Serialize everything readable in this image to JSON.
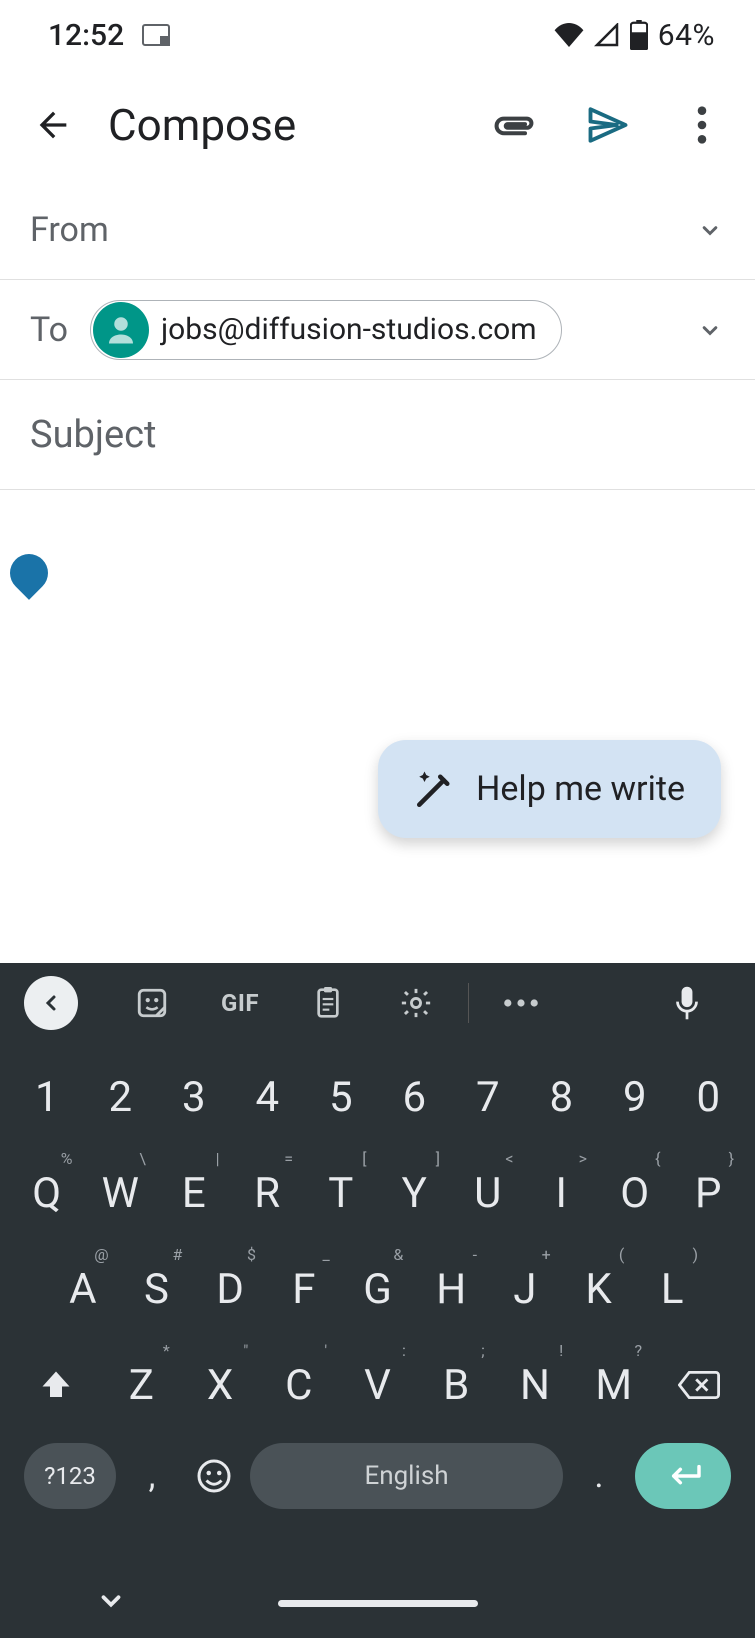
{
  "status": {
    "time": "12:52",
    "battery_pct": "64%"
  },
  "appbar": {
    "title": "Compose"
  },
  "fields": {
    "from_label": "From",
    "to_label": "To",
    "to_chip": "jobs@diffusion-studios.com",
    "subject_placeholder": "Subject"
  },
  "help_me_write": {
    "label": "Help me write"
  },
  "keyboard": {
    "suggestion_gif": "GIF",
    "row1": [
      "1",
      "2",
      "3",
      "4",
      "5",
      "6",
      "7",
      "8",
      "9",
      "0"
    ],
    "row2": {
      "keys": [
        "Q",
        "W",
        "E",
        "R",
        "T",
        "Y",
        "U",
        "I",
        "O",
        "P"
      ],
      "supers": [
        "%",
        "\\",
        "|",
        "=",
        "[",
        "]",
        "<",
        ">",
        "{",
        "}"
      ]
    },
    "row3": {
      "keys": [
        "A",
        "S",
        "D",
        "F",
        "G",
        "H",
        "J",
        "K",
        "L"
      ],
      "supers": [
        "@",
        "#",
        "$",
        "_",
        "&",
        "-",
        "+",
        "(",
        ")"
      ]
    },
    "row4": {
      "keys": [
        "Z",
        "X",
        "C",
        "V",
        "B",
        "N",
        "M"
      ],
      "supers": [
        "*",
        "\"",
        "'",
        ":",
        ";",
        "!",
        "?"
      ]
    },
    "bottom": {
      "symbols": "?123",
      "comma": ",",
      "period": ".",
      "space_label": "English"
    }
  }
}
